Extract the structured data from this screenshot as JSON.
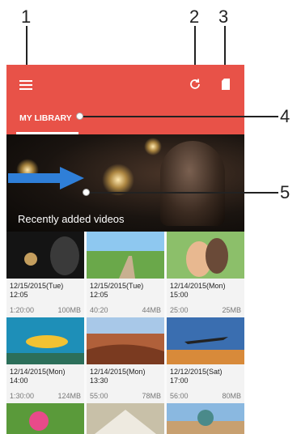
{
  "callouts": [
    "1",
    "2",
    "3",
    "4",
    "5"
  ],
  "appbar": {
    "tab_label": "MY LIBRARY",
    "accent_color": "#e85248"
  },
  "icons": {
    "menu": "menu-icon",
    "refresh": "refresh-icon",
    "storage": "sd-card-icon"
  },
  "hero": {
    "title": "Recently added videos"
  },
  "videos": [
    {
      "date": "12/15/2015(Tue)",
      "time": "12:05",
      "duration": "1:20:00",
      "size": "100MB"
    },
    {
      "date": "12/15/2015(Tue)",
      "time": "12:05",
      "duration": "40:20",
      "size": "44MB"
    },
    {
      "date": "12/14/2015(Mon)",
      "time": "15:00",
      "duration": "25:00",
      "size": "25MB"
    },
    {
      "date": "12/14/2015(Mon)",
      "time": "14:00",
      "duration": "1:30:00",
      "size": "124MB"
    },
    {
      "date": "12/14/2015(Mon)",
      "time": "13:30",
      "duration": "55:00",
      "size": "78MB"
    },
    {
      "date": "12/12/2015(Sat)",
      "time": "17:00",
      "duration": "56:00",
      "size": "80MB"
    }
  ]
}
